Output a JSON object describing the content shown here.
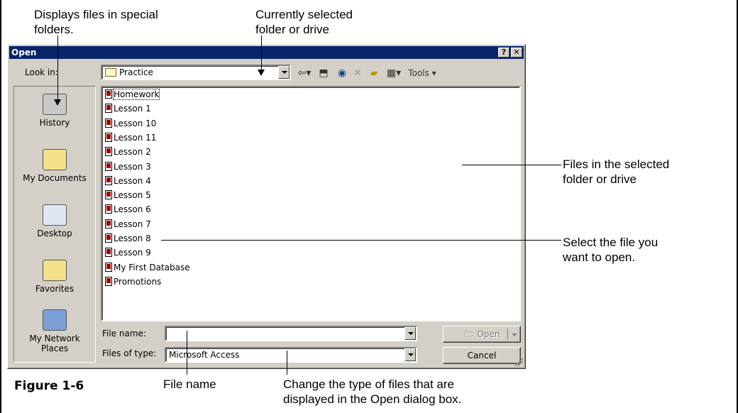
{
  "callouts": {
    "special_folders": "Displays files in special\nfolders.",
    "current_folder": "Currently selected\nfolder or drive",
    "files_in_folder": "Files in the selected\nfolder or drive",
    "select_file": "Select the file you\nwant to open.",
    "file_name": "File name",
    "change_type": "Change the type of files that are\ndisplayed in the Open dialog box."
  },
  "figure_label": "Figure 1-6",
  "dialog": {
    "title": "Open",
    "help_btn": "?",
    "close_btn": "✕",
    "look_in_label": "Look in:",
    "look_in_value": "Practice",
    "tools_label": "Tools",
    "places": [
      {
        "label": "History",
        "icon": "history-icon",
        "color": "#c8c8c8"
      },
      {
        "label": "My Documents",
        "icon": "my-documents-icon",
        "color": "#f5e08a"
      },
      {
        "label": "Desktop",
        "icon": "desktop-icon",
        "color": "#dfe7f5"
      },
      {
        "label": "Favorites",
        "icon": "favorites-icon",
        "color": "#f5e08a"
      },
      {
        "label": "My Network\nPlaces",
        "icon": "network-places-icon",
        "color": "#7aa0d6"
      }
    ],
    "files": [
      "Homework",
      "Lesson 1",
      "Lesson 10",
      "Lesson 11",
      "Lesson 2",
      "Lesson 3",
      "Lesson 4",
      "Lesson 5",
      "Lesson 6",
      "Lesson 7",
      "Lesson 8",
      "Lesson 9",
      "My First Database",
      "Promotions"
    ],
    "file_name_label": "File name:",
    "file_name_value": "",
    "files_of_type_label": "Files of type:",
    "files_of_type_value": "Microsoft Access",
    "open_button": "Open",
    "cancel_button": "Cancel"
  },
  "colors": {
    "titlebar": "#0a246a",
    "dialog_face": "#d4d0c8"
  }
}
